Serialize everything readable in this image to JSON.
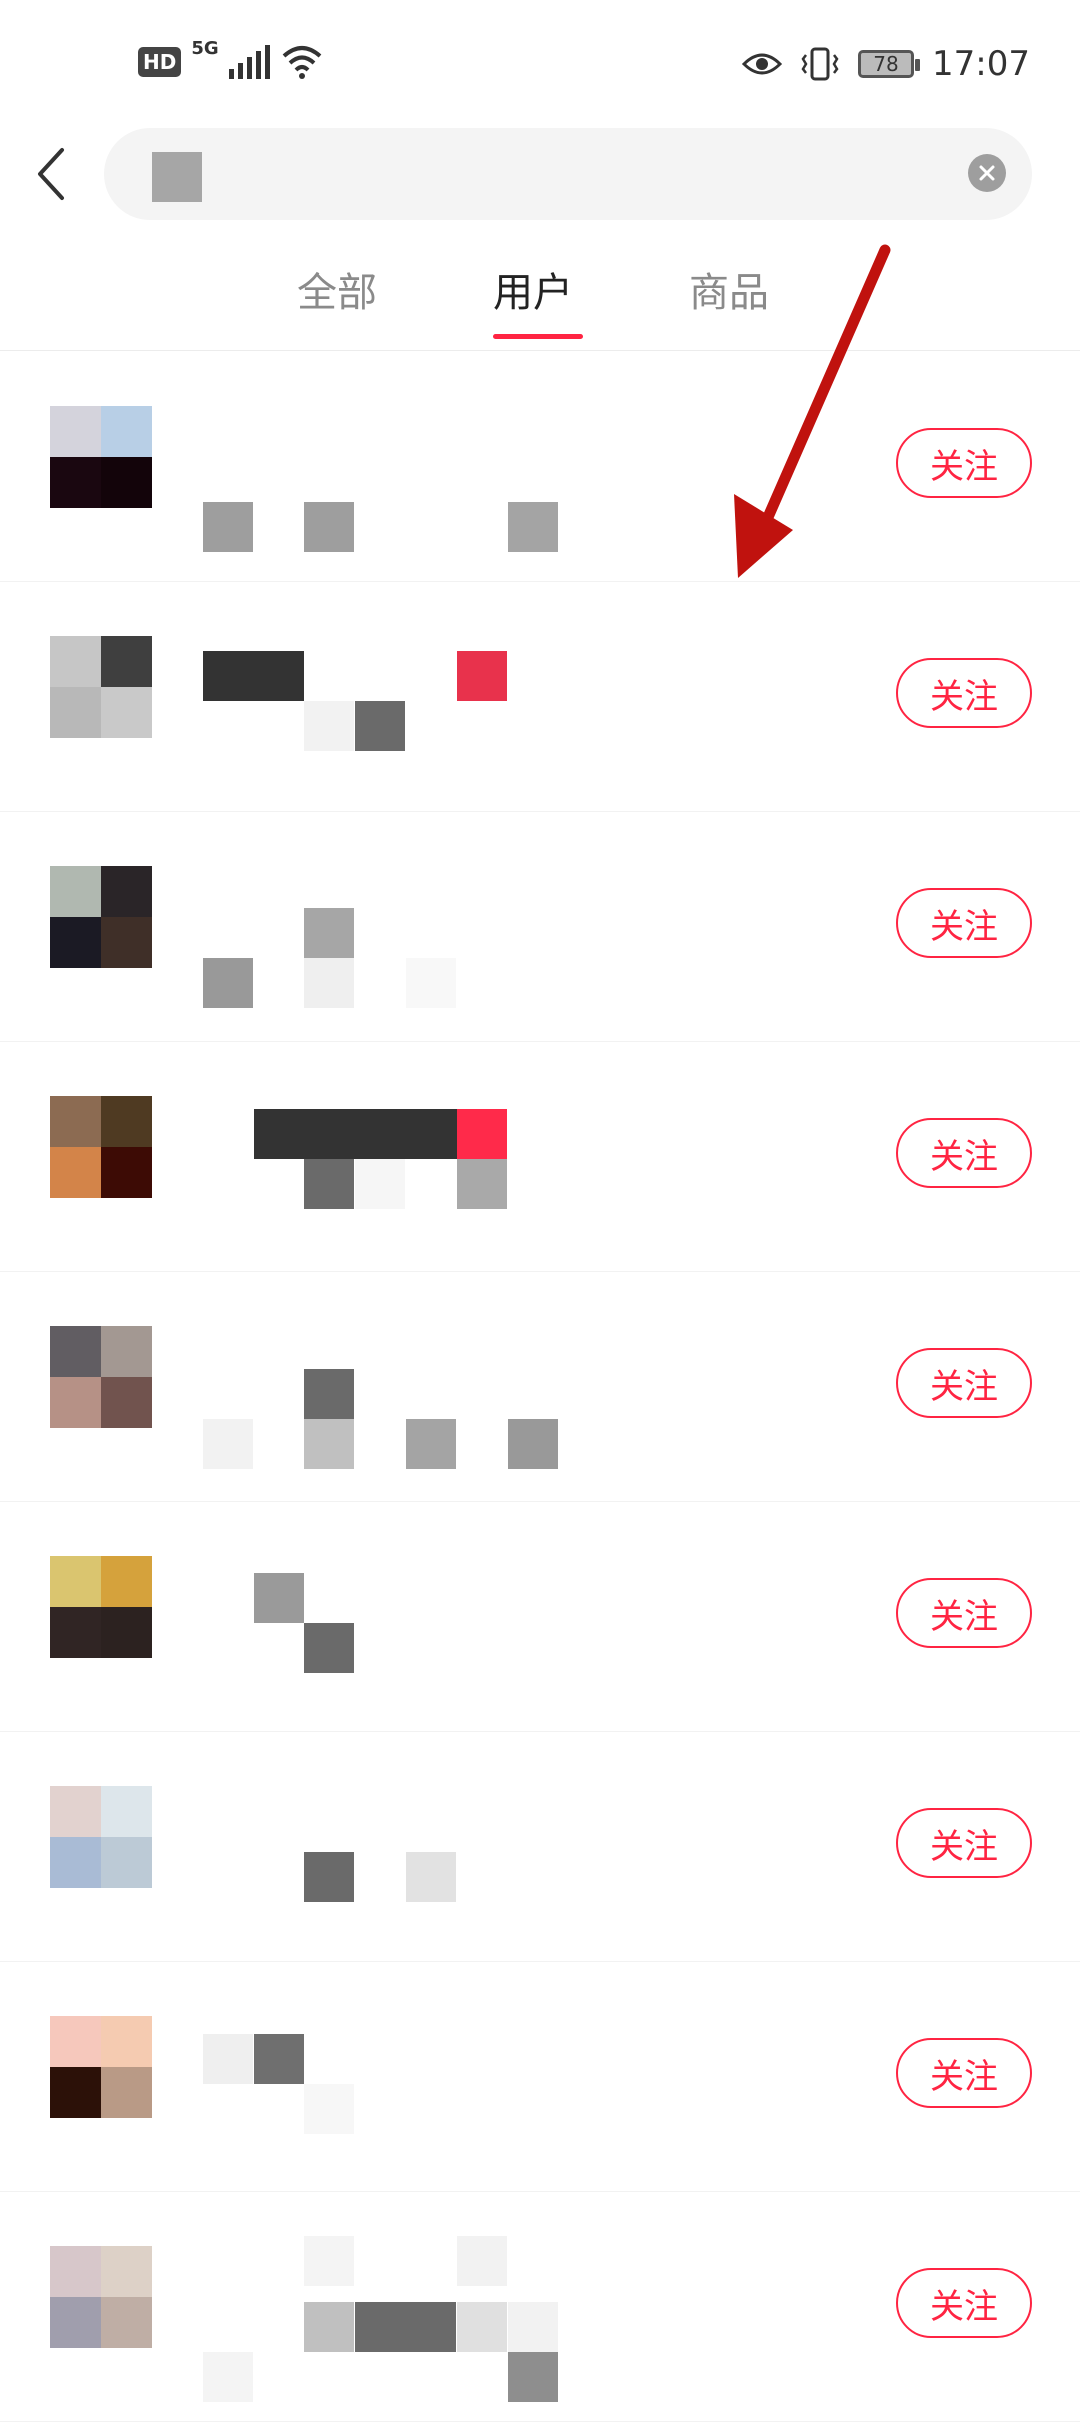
{
  "status_bar": {
    "hd": "HD",
    "network": "5G",
    "battery": "78",
    "time": "17:07"
  },
  "search": {
    "query": "",
    "clear_icon": "clear-circle-icon",
    "back_icon": "chevron-left-icon"
  },
  "tabs": [
    {
      "label": "全部",
      "active": false
    },
    {
      "label": "用户",
      "active": true
    },
    {
      "label": "商品",
      "active": false
    }
  ],
  "colors": {
    "accent": "#ff2442",
    "annotation_arrow": "#c0120e"
  },
  "users": [
    {
      "follow_label": "关注",
      "avatar": [
        "#d4d3dc",
        "#b8cfe6",
        "#1a0710",
        "#13040a"
      ]
    },
    {
      "follow_label": "关注",
      "avatar": [
        "#c6c6c6",
        "#3f3f3f",
        "#b8b8b8",
        "#c9c9c9"
      ]
    },
    {
      "follow_label": "关注",
      "avatar": [
        "#b0b8b0",
        "#2a2528",
        "#1b1a24",
        "#3f2f28"
      ]
    },
    {
      "follow_label": "关注",
      "avatar": [
        "#8c6b52",
        "#4f3a22",
        "#d38449",
        "#3d0b05"
      ]
    },
    {
      "follow_label": "关注",
      "avatar": [
        "#615d62",
        "#a39892",
        "#b69186",
        "#71534e"
      ]
    },
    {
      "follow_label": "关注",
      "avatar": [
        "#dac56f",
        "#d5a23c",
        "#302524",
        "#2c2220"
      ]
    },
    {
      "follow_label": "关注",
      "avatar": [
        "#e2d2cf",
        "#dde6eb",
        "#a9bbd5",
        "#bccad6"
      ]
    },
    {
      "follow_label": "关注",
      "avatar": [
        "#f6c8bc",
        "#f5cbb1",
        "#2c1108",
        "#b99a86"
      ]
    },
    {
      "follow_label": "关注",
      "avatar": [
        "#d7c7ca",
        "#ddd1c7",
        "#a09ead",
        "#bfaea5"
      ]
    }
  ]
}
